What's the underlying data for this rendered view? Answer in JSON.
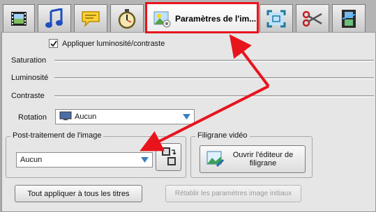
{
  "tabs": [
    {
      "name": "video",
      "icon": "film-icon"
    },
    {
      "name": "audio",
      "icon": "music-note-icon"
    },
    {
      "name": "subtitles",
      "icon": "speech-bubble-icon"
    },
    {
      "name": "timer",
      "icon": "stopwatch-icon"
    },
    {
      "name": "image-settings",
      "icon": "image-settings-icon",
      "label": "Paramètres de l'im...",
      "active": true
    },
    {
      "name": "crop",
      "icon": "crop-frame-icon"
    },
    {
      "name": "cut",
      "icon": "scissors-icon"
    },
    {
      "name": "effects",
      "icon": "film-strip-icon"
    }
  ],
  "settings": {
    "apply_brightness_label": "Appliquer luminosité/contraste",
    "apply_brightness_checked": true,
    "saturation_label": "Saturation",
    "brightness_label": "Luminosité",
    "contrast_label": "Contraste",
    "rotation_label": "Rotation",
    "rotation_value": "Aucun"
  },
  "postprocess": {
    "title": "Post-traitement de l'image",
    "value": "Aucun"
  },
  "watermark": {
    "title": "Filigrane vidéo",
    "button_label": "Ouvrir l'éditeur de filigrane"
  },
  "buttons": {
    "apply_all": "Tout appliquer à tous les titres",
    "reset": "Rétablir les paramètres image initiaux"
  },
  "colors": {
    "highlight": "#e8141c",
    "panel_bg": "#e6e6e6"
  }
}
